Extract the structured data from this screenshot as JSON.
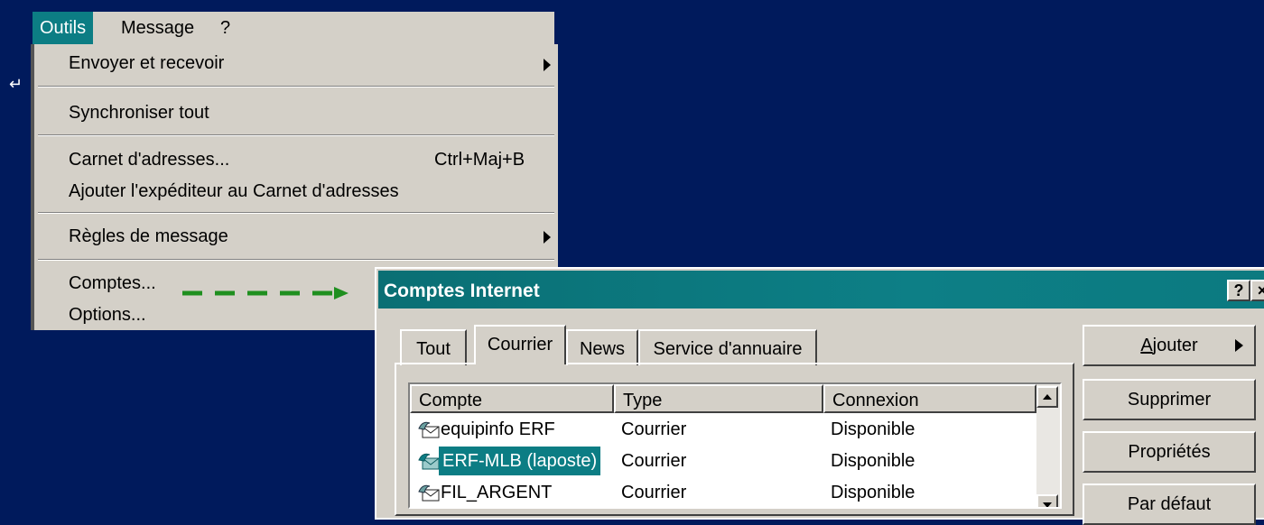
{
  "menubar": {
    "items": [
      {
        "label": "Outils",
        "active": true
      },
      {
        "label": "Message",
        "active": false
      },
      {
        "label": "?",
        "active": false
      }
    ]
  },
  "tools_menu": {
    "send_receive": "Envoyer et recevoir",
    "sync_all": "Synchroniser tout",
    "address_book": "Carnet d'adresses...",
    "address_book_shortcut": "Ctrl+Maj+B",
    "add_sender": "Ajouter l'expéditeur au Carnet d'adresses",
    "message_rules": "Règles de message",
    "accounts": "Comptes...",
    "options": "Options..."
  },
  "corner_mark": "↵",
  "dialog": {
    "title": "Comptes Internet",
    "help_btn": "?",
    "close_btn": "×",
    "tabs": [
      {
        "label": "Tout",
        "active": false
      },
      {
        "label": "Courrier",
        "active": true
      },
      {
        "label": "News",
        "active": false
      },
      {
        "label": "Service d'annuaire",
        "active": false
      }
    ],
    "columns": [
      "Compte",
      "Type",
      "Connexion"
    ],
    "rows": [
      {
        "account": "equipinfo ERF",
        "type": "Courrier",
        "connection": "Disponible",
        "selected": false
      },
      {
        "account": "ERF-MLB (laposte)",
        "type": "Courrier",
        "connection": "Disponible",
        "selected": true
      },
      {
        "account": "FIL_ARGENT",
        "type": "Courrier",
        "connection": "Disponible",
        "selected": false
      }
    ],
    "buttons": {
      "add_prefix": "A",
      "add_rest": "jouter",
      "remove": "Supprimer",
      "properties": "Propriétés",
      "default": "Par défaut"
    }
  },
  "colors": {
    "background": "#001a5c",
    "highlight": "#0c7d84",
    "arrow": "#1f8f1f"
  }
}
